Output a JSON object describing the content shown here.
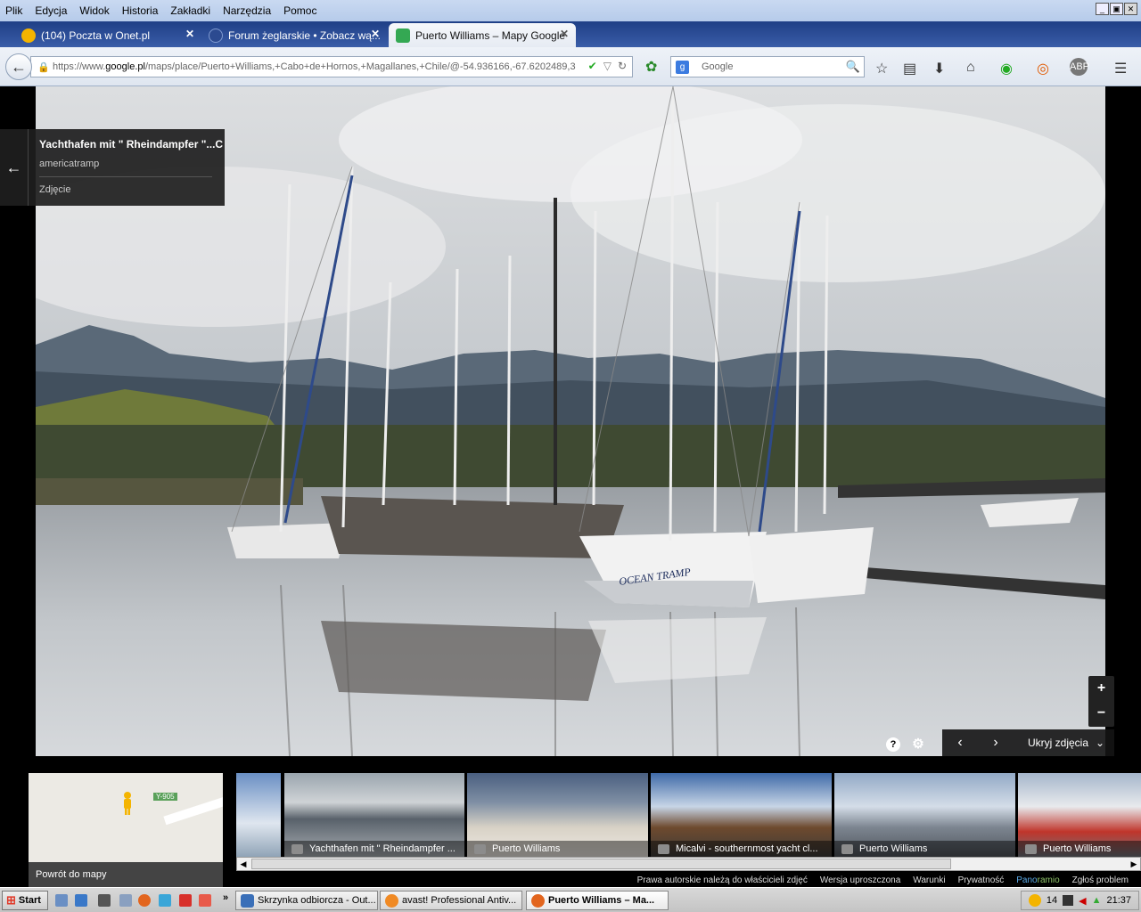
{
  "menu": [
    "Plik",
    "Edycja",
    "Widok",
    "Historia",
    "Zakładki",
    "Narzędzia",
    "Pomoc"
  ],
  "tabs": [
    {
      "label": "(104) Poczta w Onet.pl",
      "icon": "onet-icon",
      "color": "#f4b400"
    },
    {
      "label": "Forum żeglarskie • Zobacz wą...",
      "icon": "forum-icon",
      "color": "#3a5da8"
    },
    {
      "label": "Puerto Williams – Mapy Google",
      "icon": "google-maps-icon",
      "color": "#34a853"
    }
  ],
  "url": {
    "prefix": "https://www.",
    "domain": "google.pl",
    "path": "/maps/place/Puerto+Williams,+Cabo+de+Hornos,+Magallanes,+Chile/@-54.936166,-67.6202489,3"
  },
  "search": {
    "placeholder": "Google"
  },
  "panel": {
    "title": "Yachthafen mit \" Rheindampfer \"...C",
    "author": "americatramp",
    "type": "Zdjęcie"
  },
  "photo_nav": {
    "hide_label": "Ukryj zdjęcia"
  },
  "minimap": {
    "back_label": "Powrót do mapy",
    "road_sign": "Y-905"
  },
  "thumbs": [
    {
      "caption": ""
    },
    {
      "caption": "Yachthafen mit \" Rheindampfer ..."
    },
    {
      "caption": "Puerto Williams"
    },
    {
      "caption": "Micalvi - southernmost yacht cl..."
    },
    {
      "caption": "Puerto Williams"
    },
    {
      "caption": "Puerto Williams"
    }
  ],
  "footer": {
    "copyright": "Prawa autorskie należą do właścicieli zdjęć",
    "lite": "Wersja uproszczona",
    "terms": "Warunki",
    "privacy": "Prywatność",
    "pano_a": "Pano",
    "pano_b": "ramio",
    "report": "Zgłoś problem"
  },
  "taskbar": {
    "start": "Start",
    "tasks": [
      {
        "label": "Skrzynka odbiorcza - Out..."
      },
      {
        "label": "avast! Professional Antiv..."
      },
      {
        "label": "Puerto Williams – Ma..."
      }
    ],
    "tray_num": "14",
    "clock": "21:37"
  }
}
